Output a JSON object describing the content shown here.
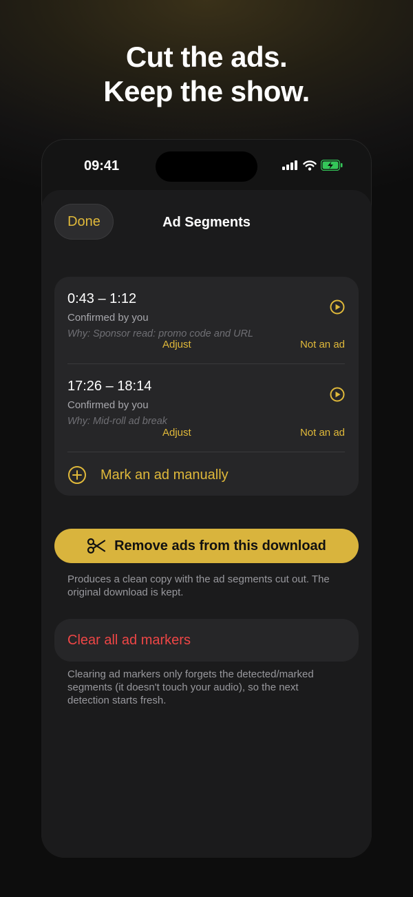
{
  "headline": {
    "line1": "Cut the ads.",
    "line2": "Keep the show."
  },
  "status_bar": {
    "time": "09:41",
    "icons": [
      "signal-bars-icon",
      "wifi-icon",
      "battery-charging-icon"
    ]
  },
  "sheet": {
    "done_label": "Done",
    "title": "Ad Segments",
    "segments": [
      {
        "time": "0:43 – 1:12",
        "status": "Confirmed by you",
        "why": "Why: Sponsor read: promo code and URL",
        "adjust_label": "Adjust",
        "not_ad_label": "Not an ad"
      },
      {
        "time": "17:26 – 18:14",
        "status": "Confirmed by you",
        "why": "Why: Mid-roll ad break",
        "adjust_label": "Adjust",
        "not_ad_label": "Not an ad"
      }
    ],
    "manual_label": "Mark an ad manually",
    "remove_button_label": "Remove ads from this download",
    "remove_note": "Produces a clean copy with the ad segments cut out. The original download is kept.",
    "clear_label": "Clear all ad markers",
    "clear_note": "Clearing ad markers only forgets the detected/marked segments (it doesn't touch your audio), so the next detection starts fresh."
  },
  "colors": {
    "accent": "#e0b93a",
    "button": "#d9b43d",
    "destructive": "#ee4646",
    "card": "#262628",
    "sheet": "#1b1b1c"
  }
}
